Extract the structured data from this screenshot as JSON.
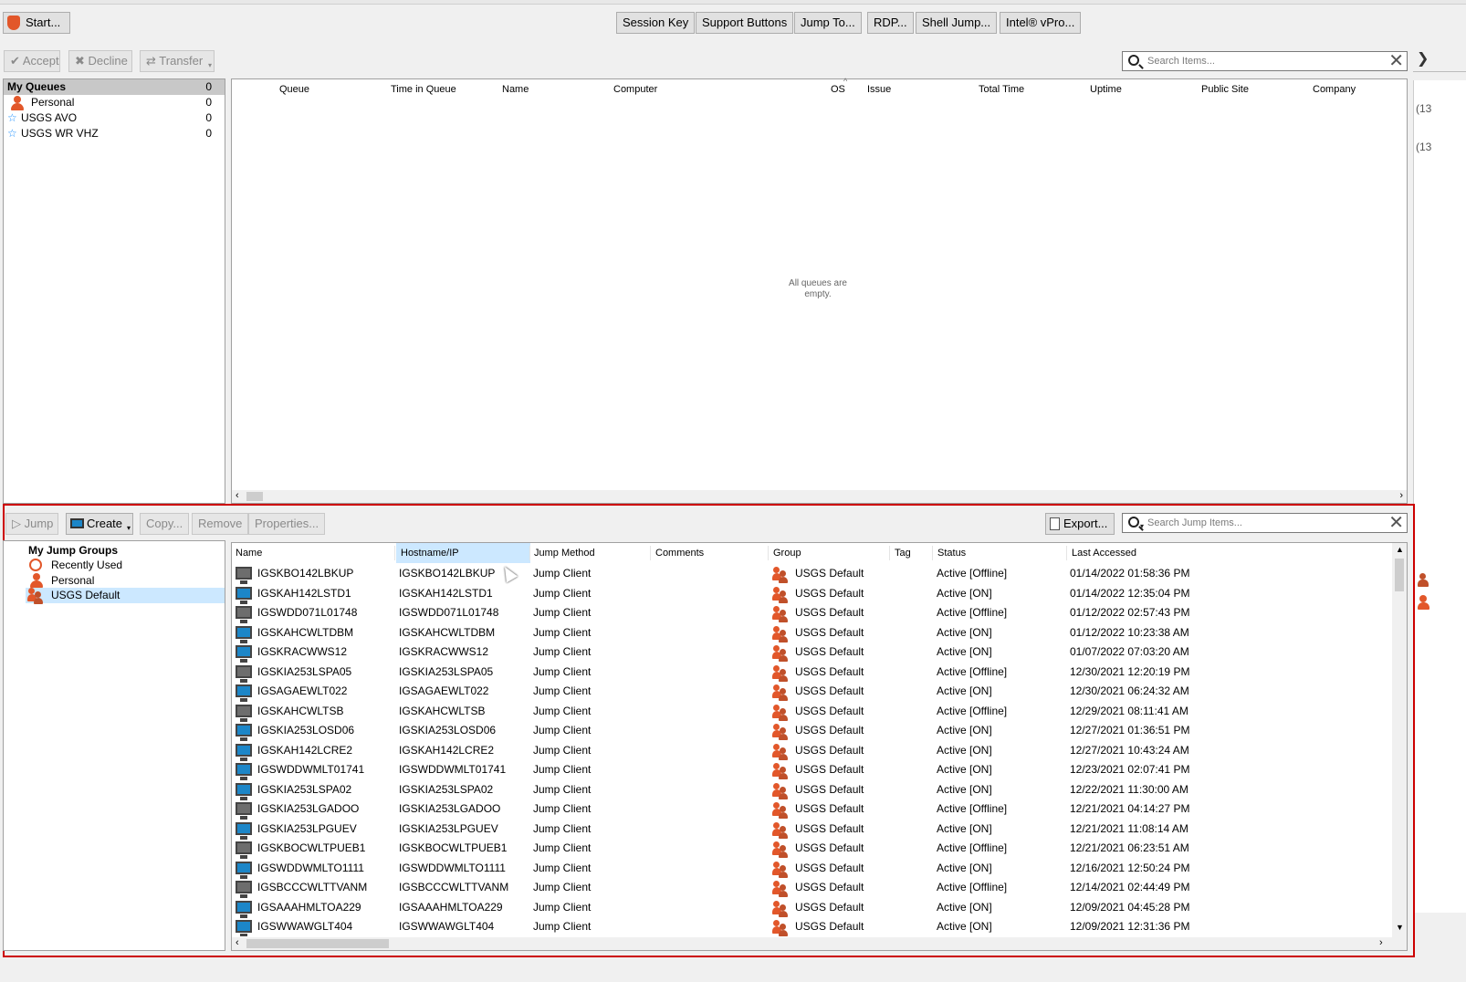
{
  "toolbar": {
    "start": "Start...",
    "buttons": [
      "Session Key",
      "Support Buttons",
      "Jump To...",
      "RDP...",
      "Shell Jump...",
      "Intel® vPro..."
    ]
  },
  "session_actions": {
    "accept": "Accept",
    "decline": "Decline",
    "transfer": "Transfer"
  },
  "queue_search": {
    "placeholder": "Search Items..."
  },
  "queues": {
    "heading": "My Queues",
    "heading_count": "0",
    "items": [
      {
        "label": "Personal",
        "count": "0",
        "icon": "person-icon"
      },
      {
        "label": "USGS AVO",
        "count": "0",
        "icon": "star-icon"
      },
      {
        "label": "USGS WR VHZ",
        "count": "0",
        "icon": "star-icon"
      }
    ]
  },
  "queue_table": {
    "columns": [
      "Queue",
      "Time in Queue",
      "Name",
      "Computer",
      "OS",
      "Issue",
      "Total Time",
      "Uptime",
      "Public Site",
      "Company"
    ],
    "empty_line1": "All queues are",
    "empty_line2": "empty."
  },
  "jump_actions": {
    "jump": "Jump",
    "create": "Create",
    "copy": "Copy...",
    "remove": "Remove",
    "properties": "Properties...",
    "export": "Export..."
  },
  "jump_search": {
    "placeholder": "Search Jump Items..."
  },
  "jump_groups": {
    "heading": "My Jump Groups",
    "items": [
      "Recently Used",
      "Personal",
      "USGS Default"
    ],
    "selected": "USGS Default"
  },
  "jump_table": {
    "columns": [
      "Name",
      "Hostname/IP",
      "Jump Method",
      "Comments",
      "Group",
      "Tag",
      "Status",
      "Last Accessed"
    ],
    "rows": [
      {
        "name": "IGSKBO142LBKUP",
        "host": "IGSKBO142LBKUP",
        "method": "Jump Client",
        "group": "USGS Default",
        "status": "Active [Offline]",
        "last": "01/14/2022 01:58:36 PM"
      },
      {
        "name": "IGSKAH142LSTD1",
        "host": "IGSKAH142LSTD1",
        "method": "Jump Client",
        "group": "USGS Default",
        "status": "Active [ON]",
        "last": "01/14/2022 12:35:04 PM"
      },
      {
        "name": "IGSWDD071L01748",
        "host": "IGSWDD071L01748",
        "method": "Jump Client",
        "group": "USGS Default",
        "status": "Active [Offline]",
        "last": "01/12/2022 02:57:43 PM"
      },
      {
        "name": "IGSKAHCWLTDBM",
        "host": "IGSKAHCWLTDBM",
        "method": "Jump Client",
        "group": "USGS Default",
        "status": "Active [ON]",
        "last": "01/12/2022 10:23:38 AM"
      },
      {
        "name": "IGSKRACWWS12",
        "host": "IGSKRACWWS12",
        "method": "Jump Client",
        "group": "USGS Default",
        "status": "Active [ON]",
        "last": "01/07/2022 07:03:20 AM"
      },
      {
        "name": "IGSKIA253LSPA05",
        "host": "IGSKIA253LSPA05",
        "method": "Jump Client",
        "group": "USGS Default",
        "status": "Active [Offline]",
        "last": "12/30/2021 12:20:19 PM"
      },
      {
        "name": "IGSAGAEWLT022",
        "host": "IGSAGAEWLT022",
        "method": "Jump Client",
        "group": "USGS Default",
        "status": "Active [ON]",
        "last": "12/30/2021 06:24:32 AM"
      },
      {
        "name": "IGSKAHCWLTSB",
        "host": "IGSKAHCWLTSB",
        "method": "Jump Client",
        "group": "USGS Default",
        "status": "Active [Offline]",
        "last": "12/29/2021 08:11:41 AM"
      },
      {
        "name": "IGSKIA253LOSD06",
        "host": "IGSKIA253LOSD06",
        "method": "Jump Client",
        "group": "USGS Default",
        "status": "Active [ON]",
        "last": "12/27/2021 01:36:51 PM"
      },
      {
        "name": "IGSKAH142LCRE2",
        "host": "IGSKAH142LCRE2",
        "method": "Jump Client",
        "group": "USGS Default",
        "status": "Active [ON]",
        "last": "12/27/2021 10:43:24 AM"
      },
      {
        "name": "IGSWDDWMLT01741",
        "host": "IGSWDDWMLT01741",
        "method": "Jump Client",
        "group": "USGS Default",
        "status": "Active [ON]",
        "last": "12/23/2021 02:07:41 PM"
      },
      {
        "name": "IGSKIA253LSPA02",
        "host": "IGSKIA253LSPA02",
        "method": "Jump Client",
        "group": "USGS Default",
        "status": "Active [ON]",
        "last": "12/22/2021 11:30:00 AM"
      },
      {
        "name": "IGSKIA253LGADOO",
        "host": "IGSKIA253LGADOO",
        "method": "Jump Client",
        "group": "USGS Default",
        "status": "Active [Offline]",
        "last": "12/21/2021 04:14:27 PM"
      },
      {
        "name": "IGSKIA253LPGUEV",
        "host": "IGSKIA253LPGUEV",
        "method": "Jump Client",
        "group": "USGS Default",
        "status": "Active [ON]",
        "last": "12/21/2021 11:08:14 AM"
      },
      {
        "name": "IGSKBOCWLTPUEB1",
        "host": "IGSKBOCWLTPUEB1",
        "method": "Jump Client",
        "group": "USGS Default",
        "status": "Active [Offline]",
        "last": "12/21/2021 06:23:51 AM"
      },
      {
        "name": "IGSWDDWMLTO1111",
        "host": "IGSWDDWMLTO1111",
        "method": "Jump Client",
        "group": "USGS Default",
        "status": "Active [ON]",
        "last": "12/16/2021 12:50:24 PM"
      },
      {
        "name": "IGSBCCCWLTTVANM",
        "host": "IGSBCCCWLTTVANM",
        "method": "Jump Client",
        "group": "USGS Default",
        "status": "Active [Offline]",
        "last": "12/14/2021 02:44:49 PM"
      },
      {
        "name": "IGSAAAHMLTOA229",
        "host": "IGSAAAHMLTOA229",
        "method": "Jump Client",
        "group": "USGS Default",
        "status": "Active [ON]",
        "last": "12/09/2021 04:45:28 PM"
      },
      {
        "name": "IGSWWAWGLT404",
        "host": "IGSWWAWGLT404",
        "method": "Jump Client",
        "group": "USGS Default",
        "status": "Active [ON]",
        "last": "12/09/2021 12:31:36 PM"
      }
    ]
  },
  "right_edge": {
    "text1": "(13",
    "text2": "(13"
  },
  "colors": {
    "highlight": "#cc0000",
    "selection": "#cce8ff",
    "accent": "#e2572a",
    "monitor_on": "#1c86c8",
    "monitor_off": "#6d6d6d"
  }
}
